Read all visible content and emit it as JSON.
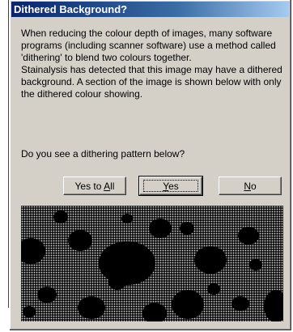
{
  "dialog": {
    "title": "Dithered Background?",
    "message_para1": "When reducing the colour depth of images, many software programs (including scanner software) use a method called 'dithering' to blend two colours together.",
    "message_para2": "Stainalysis has detected that this image may have a dithered background. A section of the image is shown below with only the dithered colour showing.",
    "question": "Do you see a dithering pattern below?"
  },
  "buttons": {
    "yes_to_all": {
      "label": "Yes to All",
      "pre": "Yes to ",
      "mnemonic": "A",
      "post": "ll"
    },
    "yes": {
      "label": "Yes",
      "pre": "",
      "mnemonic": "Y",
      "post": "es"
    },
    "no": {
      "label": "No",
      "pre": "",
      "mnemonic": "N",
      "post": "o"
    }
  },
  "colors": {
    "titlebar_start": "#0a246a",
    "dialog_face": "#d4d0c8",
    "preview_background": "#141414",
    "dither_dots": "#d8d8d8"
  }
}
